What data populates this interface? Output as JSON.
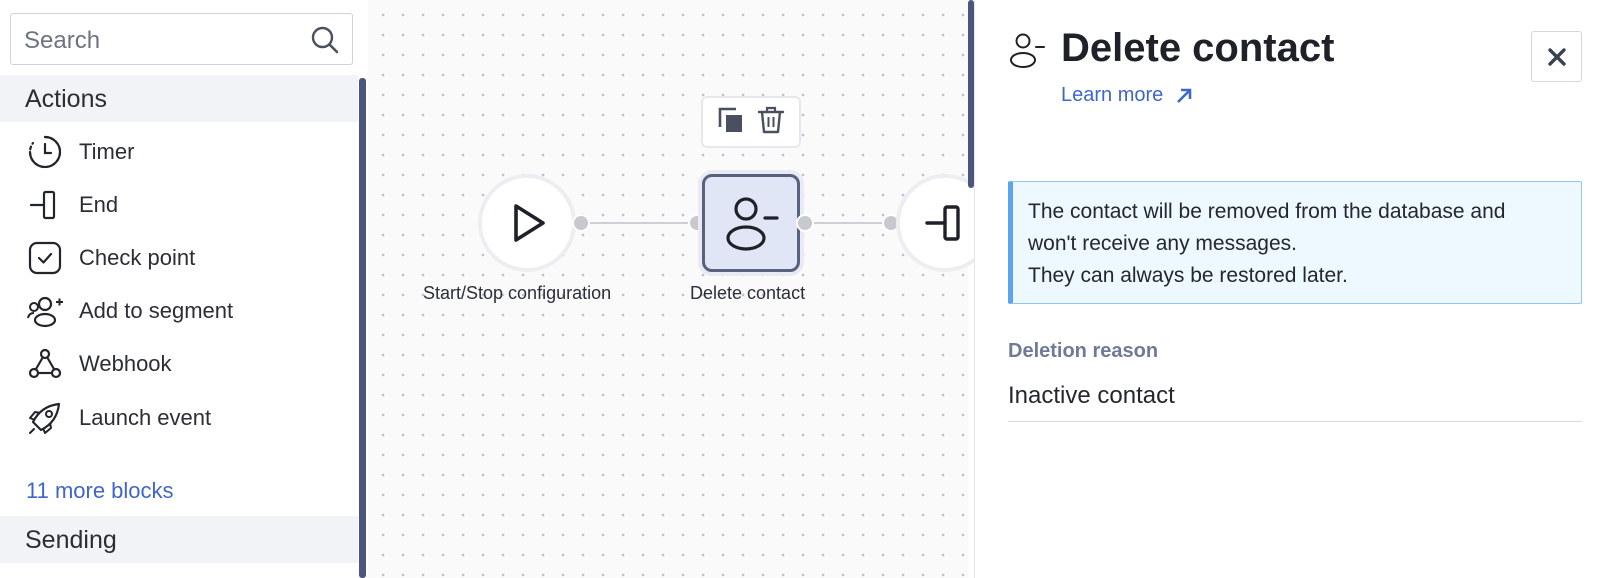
{
  "sidebar": {
    "search": {
      "placeholder": "Search",
      "icon": "search-icon"
    },
    "sections": [
      {
        "title": "Actions"
      },
      {
        "title": "Sending"
      }
    ],
    "items": [
      {
        "label": "Timer",
        "icon": "timer-icon"
      },
      {
        "label": "End",
        "icon": "end-icon"
      },
      {
        "label": "Check point",
        "icon": "check-point-icon"
      },
      {
        "label": "Add to segment",
        "icon": "add-to-segment-icon"
      },
      {
        "label": "Webhook",
        "icon": "webhook-icon"
      },
      {
        "label": "Launch event",
        "icon": "rocket-icon"
      }
    ],
    "more_link": "11 more blocks"
  },
  "canvas": {
    "nodes": [
      {
        "label": "Start/Stop configuration",
        "icon": "play-icon"
      },
      {
        "label": "Delete contact",
        "icon": "delete-contact-icon",
        "selected": true
      },
      {
        "label": "",
        "icon": "end-icon"
      }
    ],
    "toolbar": {
      "duplicate_icon": "copy-icon",
      "delete_icon": "trash-icon"
    }
  },
  "panel": {
    "title": "Delete contact",
    "icon": "delete-contact-icon",
    "learn_more": "Learn more",
    "close_icon": "close-icon",
    "info_lines": [
      "The contact will be removed from the database and",
      "won't receive any messages.",
      "They can always be restored later."
    ],
    "field": {
      "label": "Deletion reason",
      "value": "Inactive contact"
    }
  },
  "colors": {
    "accent": "#3f66c8",
    "node_selected_bg": "#e1e6f7",
    "node_selected_border": "#58627f",
    "info_bg": "#eef8ff",
    "info_border": "#5aa5ec",
    "scrollbar": "#4a567e"
  }
}
